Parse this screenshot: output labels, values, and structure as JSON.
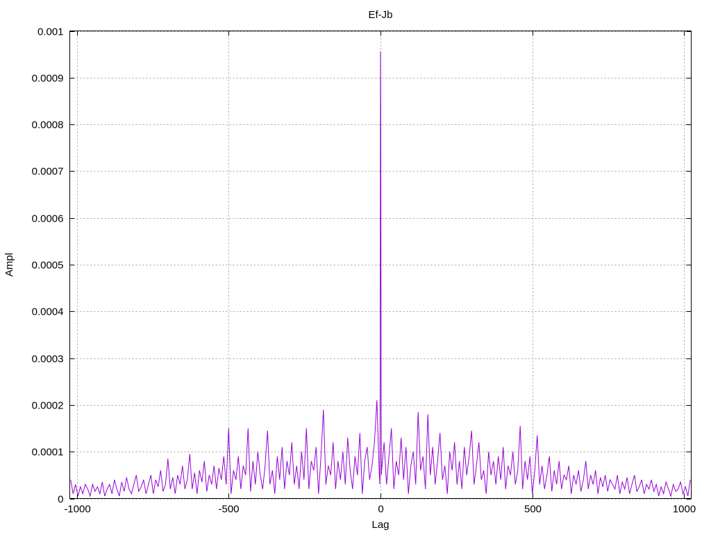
{
  "chart_data": {
    "type": "line",
    "title": "Ef-Jb",
    "xlabel": "Lag",
    "ylabel": "Ampl",
    "xlim": [
      -1023,
      1023
    ],
    "ylim": [
      0,
      0.001
    ],
    "xticks": [
      -1000,
      -500,
      0,
      500,
      1000
    ],
    "xtick_labels": [
      "-1000",
      "-500",
      "0",
      "500",
      "1000"
    ],
    "yticks": [
      0,
      0.0001,
      0.0002,
      0.0003,
      0.0004,
      0.0005,
      0.0006,
      0.0007,
      0.0008,
      0.0009,
      0.001
    ],
    "ytick_labels": [
      "0",
      "0.0001",
      "0.0002",
      "0.0003",
      "0.0004",
      "0.0005",
      "0.0006",
      "0.0007",
      "0.0008",
      "0.0009",
      "0.001"
    ],
    "grid": true,
    "series": [
      {
        "name": "Ef-Jb",
        "color": "#9400d3",
        "value_scale": 1e-05,
        "x_start": -1020,
        "x_step": 8,
        "values": [
          4,
          1,
          3,
          0.5,
          2.5,
          1,
          3,
          2,
          0.5,
          3,
          1.5,
          2.5,
          1,
          3.5,
          0.5,
          2,
          3,
          1,
          4,
          2,
          0.5,
          3.5,
          1.5,
          4.5,
          2,
          1,
          3,
          5,
          1.5,
          2.5,
          4,
          1,
          3,
          5,
          1,
          4,
          2.5,
          6,
          1.5,
          3,
          8.5,
          2,
          4.5,
          1,
          5,
          3,
          7,
          2,
          4,
          9.5,
          2,
          5.5,
          1,
          6,
          3.5,
          8,
          1.5,
          5,
          3,
          7,
          2,
          6.5,
          4,
          9,
          3,
          15,
          1,
          6,
          4,
          9,
          2,
          7,
          5,
          15,
          1.5,
          8,
          3,
          10,
          5,
          2,
          7,
          14.5,
          3,
          6,
          1,
          9,
          4,
          11,
          2,
          8,
          5,
          12,
          3,
          7,
          2,
          10,
          4,
          15,
          2,
          8,
          6,
          11,
          1,
          9,
          19,
          3,
          7,
          5,
          12,
          2,
          8,
          4,
          10,
          3,
          13,
          6,
          2,
          9,
          5,
          14,
          1,
          8,
          11,
          4,
          7,
          12,
          21,
          5,
          6,
          12,
          3,
          9,
          15,
          2,
          8,
          5,
          13,
          4,
          11,
          1,
          7,
          10,
          3,
          18.5,
          6,
          9,
          2,
          18,
          5,
          11,
          3,
          8,
          14,
          4,
          7,
          1,
          10,
          6,
          12,
          3,
          8,
          2,
          11,
          5,
          9,
          14.5,
          3,
          7,
          12,
          4,
          6,
          1,
          10,
          5,
          8,
          3,
          9,
          4,
          11,
          2,
          7,
          5,
          10,
          3,
          6,
          15.5,
          2,
          8,
          4,
          9,
          1,
          6,
          13.5,
          3,
          7,
          2,
          5,
          9,
          1.5,
          6,
          3,
          8,
          2,
          5,
          4,
          7,
          1,
          5,
          3,
          6,
          1.5,
          4,
          8,
          2,
          5,
          3,
          6,
          1,
          4.5,
          2.5,
          5,
          1.5,
          4,
          3,
          2,
          5,
          1,
          3.5,
          2,
          4.5,
          1,
          3,
          5,
          1.5,
          2.5,
          4,
          1,
          3,
          2,
          4,
          1.5,
          3,
          0.5,
          2.5,
          1,
          3.5,
          2,
          0.5,
          3,
          1.5,
          2,
          3.5,
          1,
          2.5,
          0.5,
          4
        ],
        "extra_points": [
          [
            -2,
            3
          ],
          [
            -1,
            28
          ],
          [
            0,
            95.6
          ],
          [
            1,
            80.8
          ],
          [
            2,
            27
          ],
          [
            3,
            5
          ]
        ]
      }
    ]
  }
}
